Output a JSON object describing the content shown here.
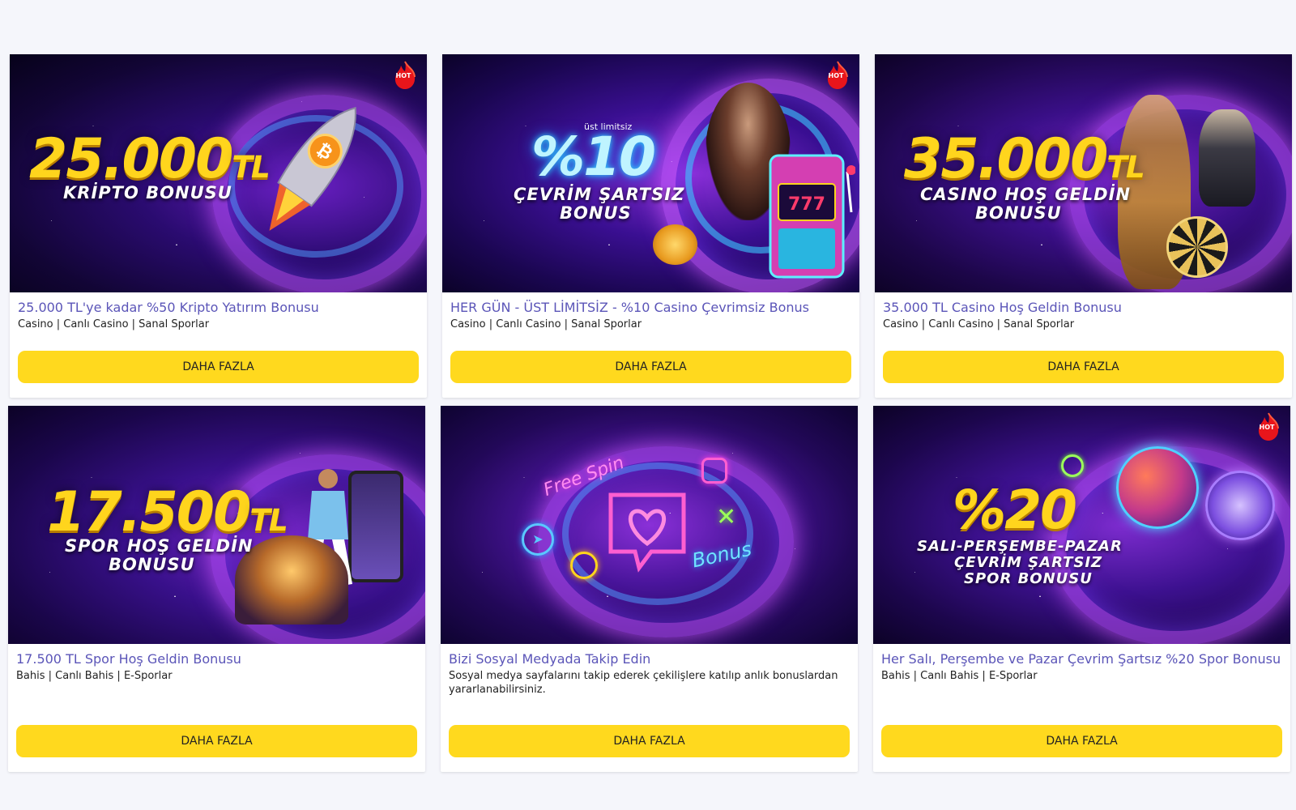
{
  "colors": {
    "page_bg": "#f5f6fb",
    "button_bg": "#ffd91e",
    "title_color": "#5b55b8",
    "headline_yellow": "#ffd51d",
    "hot_red": "#e8151b"
  },
  "hot_label": "HOT",
  "cards": [
    {
      "headline": "25.000",
      "headline_unit": "TL",
      "subline1": "KRİPTO BONUSU",
      "subline2": "",
      "hot": true,
      "title": "25.000 TL'ye kadar %50 Kripto Yatırım Bonusu",
      "description": "Casino | Canlı Casino | Sanal Sporlar",
      "button": "DAHA FAZLA",
      "icon": "bitcoin-rocket-icon"
    },
    {
      "headline_small": "üst limitsiz",
      "headline": "%10",
      "subline1": "ÇEVRİM ŞARTSIZ",
      "subline2": "BONUS",
      "hot": true,
      "title": "HER GÜN - ÜST LİMİTSİZ - %10 Casino Çevrimsiz Bonus",
      "description": "Casino | Canlı Casino | Sanal Sporlar",
      "button": "DAHA FAZLA",
      "icon": "slot-machine-icon"
    },
    {
      "headline": "35.000",
      "headline_unit": "TL",
      "subline1": "CASINO HOŞ GELDİN",
      "subline2": "BONUSU",
      "hot": false,
      "title": "35.000 TL Casino Hoş Geldin Bonusu",
      "description": "Casino | Canlı Casino | Sanal Sporlar",
      "button": "DAHA FAZLA",
      "icon": "casino-chips-icon"
    },
    {
      "headline": "17.500",
      "headline_unit": "TL",
      "subline1": "SPOR HOŞ GELDİN",
      "subline2": "BONUSU",
      "hot": false,
      "title": "17.500 TL Spor Hoş Geldin Bonusu",
      "description": "Bahis | Canlı Bahis | E-Sporlar",
      "button": "DAHA FAZLA",
      "icon": "football-players-icon"
    },
    {
      "neon_text1": "Free Spin",
      "neon_text2": "Bonus",
      "hot": false,
      "title": "Bizi Sosyal Medyada Takip Edin",
      "description": "Sosyal medya sayfalarını takip ederek çekilişlere katılıp anlık bonuslardan yararlanabilirsiniz.",
      "button": "DAHA FAZLA",
      "icon": "heart-chat-icon"
    },
    {
      "headline": "%20",
      "subline1": "SALI-PERŞEMBE-PAZAR",
      "subline2": "ÇEVRİM ŞARTSIZ",
      "subline3": "SPOR BONUSU",
      "hot": true,
      "title": "Her Salı, Perşembe ve Pazar Çevrim Şartsız %20 Spor Bonusu",
      "description": "Bahis | Canlı Bahis | E-Sporlar",
      "button": "DAHA FAZLA",
      "icon": "sports-balls-icon"
    }
  ]
}
